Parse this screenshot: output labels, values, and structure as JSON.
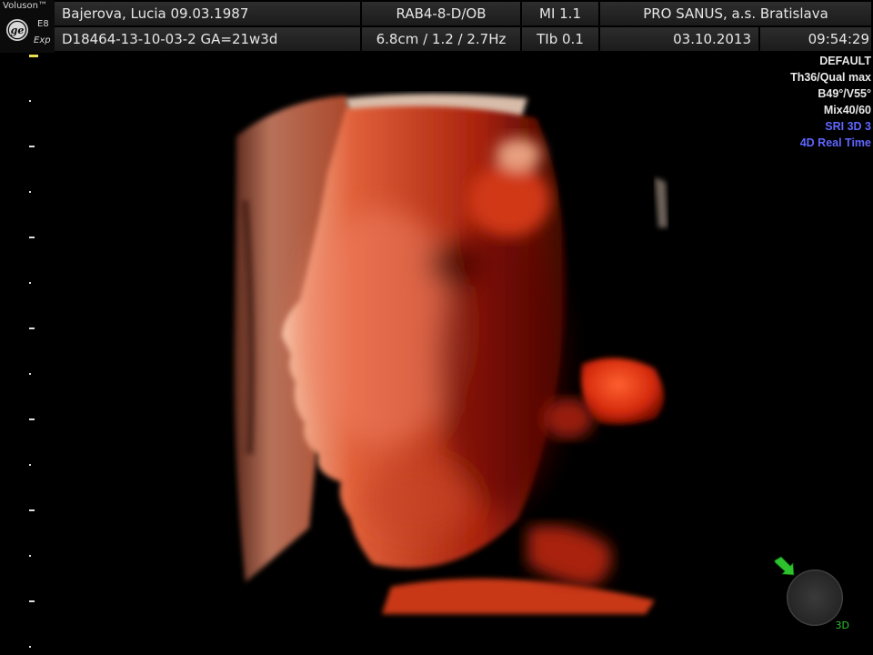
{
  "header": {
    "brand": "Voluson™",
    "model": "E8",
    "mode": "Exp",
    "patient": "Bajerova, Lucia  09.03.1987",
    "probe": "RAB4-8-D/OB",
    "mi": "MI  1.1",
    "institution": "PRO SANUS, a.s. Bratislava",
    "exam_id": "D18464-13-10-03-2  GA=21w3d",
    "params": "6.8cm / 1.2 / 2.7Hz",
    "tib": "TIb  0.1",
    "date": "03.10.2013",
    "time": "09:54:29"
  },
  "preset": {
    "lines": [
      "DEFAULT",
      "Th36/Qual max",
      "B49°/V55°",
      "Mix40/60"
    ],
    "blue_lines": [
      "SRI 3D 3",
      "4D Real Time"
    ],
    "blue_color": "#5f66ff"
  },
  "orientation": {
    "label": "3D",
    "arrow_color": "#2ec22e"
  },
  "icons": {
    "ge": "ge-logo-icon",
    "arrow": "green-arrow-icon"
  }
}
